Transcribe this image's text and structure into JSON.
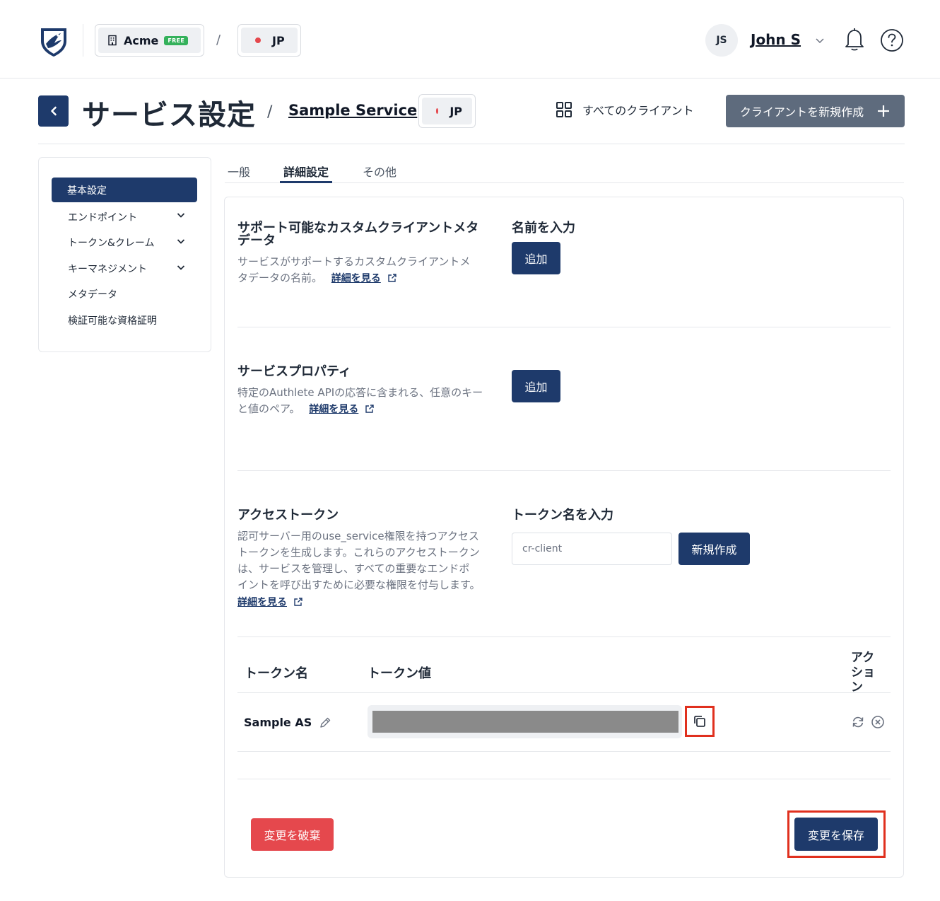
{
  "topbar": {
    "org_name": "Acme",
    "org_plan": "FREE",
    "breadcrumb_sep": "/",
    "region": "JP",
    "user_initials": "JS",
    "user_name": "John S"
  },
  "header": {
    "title": "サービス設定",
    "title_sep": "/",
    "service_name": "Sample Service",
    "region": "JP",
    "all_clients_label": "すべてのクライアント",
    "new_client_label": "クライアントを新規作成"
  },
  "sidebar": {
    "items": [
      {
        "label": "基本設定",
        "active": true
      },
      {
        "label": "エンドポイント",
        "expandable": true
      },
      {
        "label": "トークン&クレーム",
        "expandable": true
      },
      {
        "label": "キーマネジメント",
        "expandable": true
      },
      {
        "label": "メタデータ"
      },
      {
        "label": "検証可能な資格証明"
      }
    ]
  },
  "tabs": [
    {
      "label": "一般"
    },
    {
      "label": "詳細設定",
      "active": true
    },
    {
      "label": "その他"
    }
  ],
  "sections": {
    "custom_metadata": {
      "title_line1": "サポート可能なカスタムクライアントメタ",
      "title_line2": "データ",
      "desc_line1": "サービスがサポートするカスタムクライアントメ",
      "desc_line2": "タデータの名前。",
      "link": "詳細を見る",
      "field_label": "名前を入力",
      "add_button": "追加"
    },
    "service_properties": {
      "title": "サービスプロパティ",
      "desc_line1": "特定のAuthlete APIの応答に含まれる、任意のキー",
      "desc_line2": "と値のペア。",
      "link": "詳細を見る",
      "add_button": "追加"
    },
    "access_token": {
      "title": "アクセストークン",
      "desc_line1": "認可サーバー用のuse_service権限を持つアクセス",
      "desc_line2": "トークンを生成します。これらのアクセストークン",
      "desc_line3": "は、サービスを管理し、すべての重要なエンドポ",
      "desc_line4": "イントを呼び出すために必要な権限を付与します。",
      "link": "詳細を見る",
      "field_label": "トークン名を入力",
      "input_value": "cr-client",
      "create_button": "新規作成"
    }
  },
  "token_table": {
    "col_name": "トークン名",
    "col_value": "トークン値",
    "col_actions_1": "アク",
    "col_actions_2": "ショ",
    "col_actions_3": "ン",
    "rows": [
      {
        "name": "Sample AS"
      }
    ]
  },
  "footer": {
    "discard_label": "変更を破棄",
    "save_label": "変更を保存"
  },
  "colors": {
    "navy": "#1e3a6b",
    "slate_button": "#5e6b7d",
    "danger": "#e5484d",
    "highlight": "#e0301e",
    "free_badge": "#34b15b"
  }
}
